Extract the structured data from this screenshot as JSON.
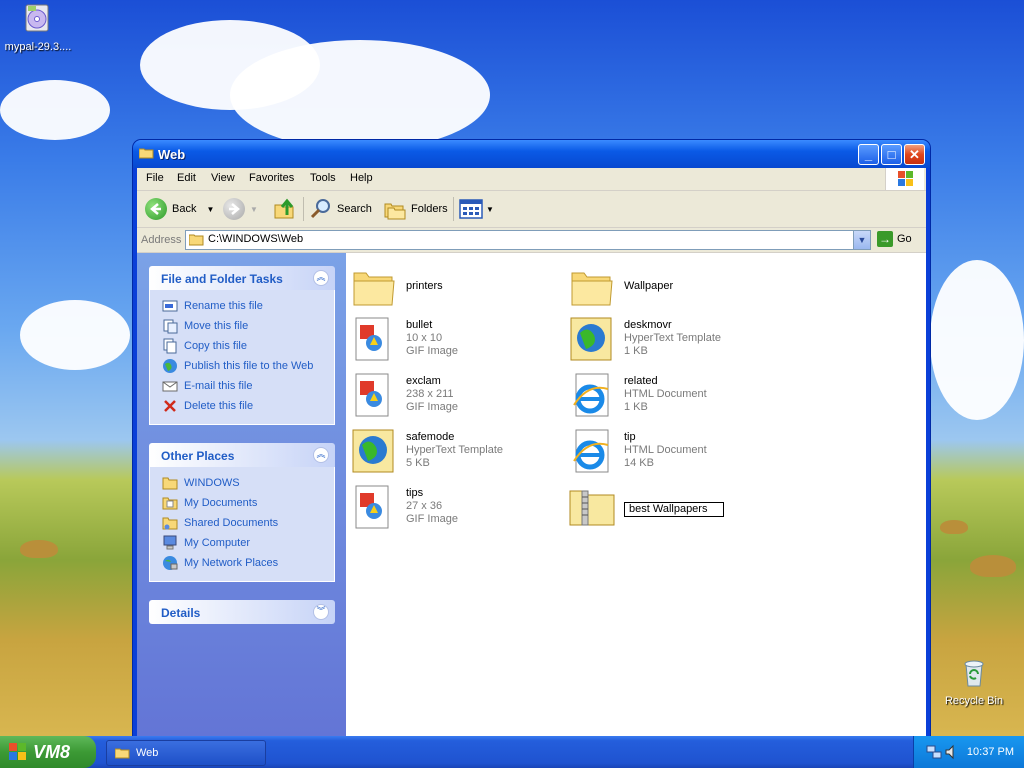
{
  "desktop": {
    "icons": [
      {
        "label": "mypal-29.3...."
      },
      {
        "label": "Recycle Bin"
      }
    ]
  },
  "window": {
    "title": "Web",
    "menu": [
      "File",
      "Edit",
      "View",
      "Favorites",
      "Tools",
      "Help"
    ],
    "toolbar": {
      "back": "Back",
      "search": "Search",
      "folders": "Folders"
    },
    "address": {
      "label": "Address",
      "value": "C:\\WINDOWS\\Web",
      "go": "Go"
    }
  },
  "taskpane": {
    "file_tasks": {
      "title": "File and Folder Tasks",
      "items": [
        "Rename this file",
        "Move this file",
        "Copy this file",
        "Publish this file to the Web",
        "E-mail this file",
        "Delete this file"
      ]
    },
    "other_places": {
      "title": "Other Places",
      "items": [
        "WINDOWS",
        "My Documents",
        "Shared Documents",
        "My Computer",
        "My Network Places"
      ]
    },
    "details": {
      "title": "Details"
    }
  },
  "files": [
    {
      "name": "printers",
      "type": "folder"
    },
    {
      "name": "Wallpaper",
      "type": "folder"
    },
    {
      "name": "bullet",
      "line1": "10 x 10",
      "line2": "GIF Image",
      "type": "gif"
    },
    {
      "name": "deskmovr",
      "line1": "HyperText Template",
      "line2": "1 KB",
      "type": "htt"
    },
    {
      "name": "exclam",
      "line1": "238 x 211",
      "line2": "GIF Image",
      "type": "gif"
    },
    {
      "name": "related",
      "line1": "HTML Document",
      "line2": "1 KB",
      "type": "html"
    },
    {
      "name": "safemode",
      "line1": "HyperText Template",
      "line2": "5 KB",
      "type": "htt"
    },
    {
      "name": "tip",
      "line1": "HTML Document",
      "line2": "14 KB",
      "type": "html"
    },
    {
      "name": "tips",
      "line1": "27 x 36",
      "line2": "GIF Image",
      "type": "gif"
    },
    {
      "name": "best Wallpapers",
      "type": "zip",
      "renaming": true
    }
  ],
  "taskbar": {
    "start_label": "VM8",
    "task_label": "Web",
    "clock": "10:37 PM"
  }
}
